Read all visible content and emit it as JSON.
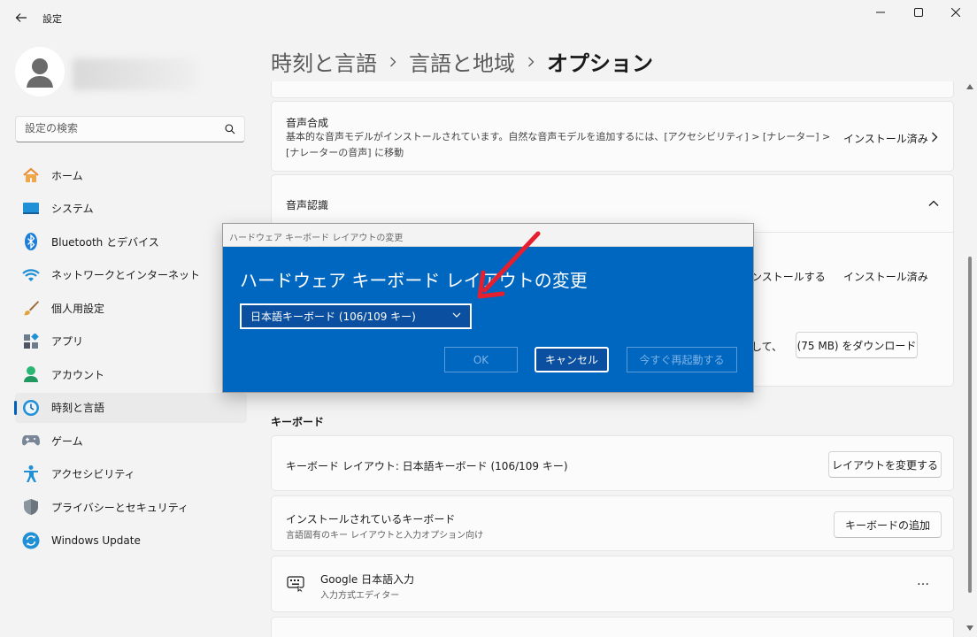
{
  "window": {
    "title": "設定",
    "controls": [
      "minimize-icon",
      "maximize-icon",
      "close-icon"
    ]
  },
  "sidebar": {
    "search_placeholder": "設定の検索",
    "items": [
      {
        "label": "ホーム",
        "icon": "home-icon"
      },
      {
        "label": "システム",
        "icon": "system-icon"
      },
      {
        "label": "Bluetooth とデバイス",
        "icon": "bluetooth-icon"
      },
      {
        "label": "ネットワークとインターネット",
        "icon": "wifi-icon"
      },
      {
        "label": "個人用設定",
        "icon": "brush-icon"
      },
      {
        "label": "アプリ",
        "icon": "apps-icon"
      },
      {
        "label": "アカウント",
        "icon": "account-icon"
      },
      {
        "label": "時刻と言語",
        "icon": "time-language-icon",
        "active": true
      },
      {
        "label": "ゲーム",
        "icon": "gamepad-icon"
      },
      {
        "label": "アクセシビリティ",
        "icon": "accessibility-icon"
      },
      {
        "label": "プライバシーとセキュリティ",
        "icon": "shield-icon"
      },
      {
        "label": "Windows Update",
        "icon": "update-icon"
      }
    ]
  },
  "breadcrumb": {
    "part1": "時刻と言語",
    "part2": "言語と地域",
    "current": "オプション"
  },
  "speech_synthesis": {
    "title": "音声合成",
    "desc": "基本的な音声モデルがインストールされています。自然な音声モデルを追加するには、[アクセシビリティ] > [ナレーター] > [ナレーターの音声] に移動",
    "status": "インストール済み"
  },
  "speech_recognition": {
    "title": "音声認識",
    "row1_install": "ンストールする",
    "row1_status": "インストール済み",
    "row2_partial": "して、",
    "download_button": "(75 MB) をダウンロード"
  },
  "keyboard": {
    "section_title": "キーボード",
    "layout_label": "キーボード レイアウト: 日本語キーボード (106/109 キー)",
    "change_layout_button": "レイアウトを変更する",
    "installed_title": "インストールされているキーボード",
    "installed_sub": "言語固有のキー レイアウトと入力オプション向け",
    "add_keyboard_button": "キーボードの追加",
    "ime_name": "Google 日本語入力",
    "ime_sub": "入力方式エディター",
    "more": "…"
  },
  "dialog": {
    "window_title": "ハードウェア キーボード レイアウトの変更",
    "heading": "ハードウェア キーボード レイアウトの変更",
    "selected_layout": "日本語キーボード (106/109 キー)",
    "ok": "OK",
    "cancel": "キャンセル",
    "restart": "今すぐ再起動する"
  },
  "colors": {
    "accent": "#005fb8",
    "dialog_bg": "#0067c0",
    "annotation_arrow": "#e5202e"
  }
}
